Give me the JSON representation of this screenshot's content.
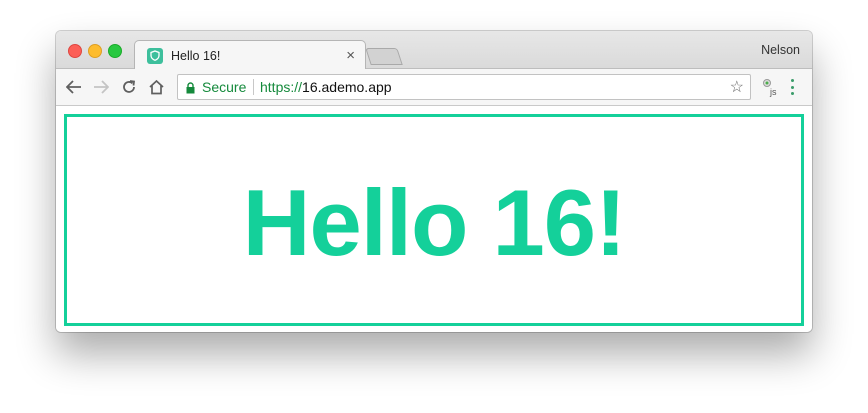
{
  "browser": {
    "profile_name": "Nelson",
    "tab": {
      "title": "Hello 16!",
      "favicon": "shield-icon",
      "close_label": "×"
    },
    "address_bar": {
      "security_label": "Secure",
      "url_scheme": "https://",
      "url_host": "16.ademo.app",
      "bookmark_icon": "☆"
    },
    "extension_label": "JS"
  },
  "page": {
    "heading": "Hello 16!",
    "accent_color": "#14d09a"
  }
}
